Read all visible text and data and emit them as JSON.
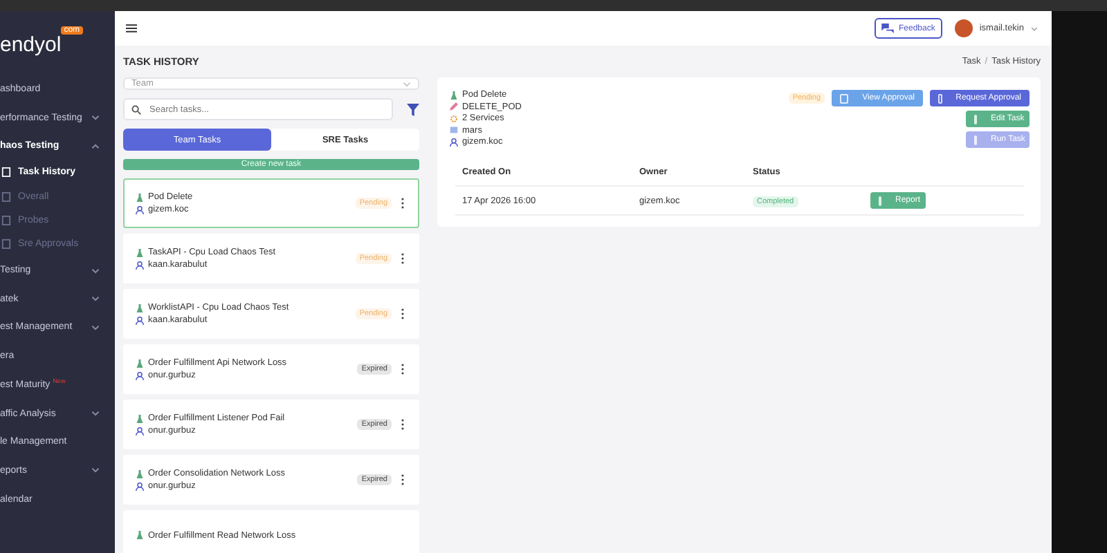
{
  "sidebar": {
    "logo": "endyol",
    "logo_badge": "com",
    "items": [
      {
        "label": "ashboard"
      },
      {
        "label": "erformance Testing",
        "expanded": false
      },
      {
        "label": "haos Testing",
        "expanded": true,
        "children": [
          {
            "label": "Task History",
            "selected": true
          },
          {
            "label": "Overall",
            "selected": false
          },
          {
            "label": "Probes",
            "selected": false
          },
          {
            "label": "Sre Approvals",
            "selected": false
          }
        ]
      },
      {
        "label": "Testing",
        "expanded": false
      },
      {
        "label": "atek",
        "expanded": false
      },
      {
        "label": "est Management",
        "expanded": false
      },
      {
        "label": "era"
      },
      {
        "label": "est Maturity",
        "badge": "New"
      },
      {
        "label": "affic Analysis",
        "expanded": false
      },
      {
        "label": "le Management"
      },
      {
        "label": "eports",
        "expanded": false
      },
      {
        "label": "alendar"
      }
    ]
  },
  "header": {
    "feedback": "Feedback",
    "user": "ismail.tekin"
  },
  "page": {
    "title": "TASK HISTORY",
    "breadcrumb": [
      "Task",
      "/",
      "Task History"
    ]
  },
  "filters": {
    "team_placeholder": "Team",
    "search_placeholder": "Search tasks..."
  },
  "tabs": [
    {
      "label": "Team Tasks",
      "selected": true
    },
    {
      "label": "SRE Tasks",
      "selected": false
    }
  ],
  "create_button": "Create new task",
  "tasks": [
    {
      "title": "Pod Delete",
      "owner": "gizem.koc",
      "status": "Pending",
      "color": "#f0b060",
      "selected": true
    },
    {
      "title": "TaskAPI - Cpu Load Chaos Test",
      "owner": "kaan.karabulut",
      "status": "Pending",
      "color": "#f0b060",
      "selected": false
    },
    {
      "title": "WorklistAPI - Cpu Load Chaos Test",
      "owner": "kaan.karabulut",
      "status": "Pending",
      "color": "#f0b060",
      "selected": false
    },
    {
      "title": "Order Fulfillment Api Network Loss",
      "owner": "onur.gurbuz",
      "status": "Expired",
      "color": "#444444",
      "selected": false
    },
    {
      "title": "Order Fulfillment Listener Pod Fail",
      "owner": "onur.gurbuz",
      "status": "Expired",
      "color": "#444444",
      "selected": false
    },
    {
      "title": "Order Consolidation Network Loss",
      "owner": "onur.gurbuz",
      "status": "Expired",
      "color": "#444444",
      "selected": false
    },
    {
      "title": "Order Fulfillment Read Network Loss",
      "selected": false
    }
  ],
  "detail": {
    "name": "Pod Delete",
    "type": "DELETE_POD",
    "services": "2 Services",
    "cluster": "mars",
    "owner": "gizem.koc",
    "status": "Pending",
    "buttons": [
      {
        "label": "View Approval",
        "kind": "view"
      },
      {
        "label": "Request Approval",
        "kind": "request"
      },
      {
        "label": "Edit Task",
        "kind": "edit"
      },
      {
        "label": "Run Task",
        "kind": "run"
      }
    ],
    "table": {
      "columns": [
        "Created On",
        "Owner",
        "Status"
      ],
      "rows": [
        {
          "created": "17 Apr 2026 16:00",
          "owner": "gizem.koc",
          "status": "Completed",
          "action": "Report"
        }
      ]
    }
  }
}
